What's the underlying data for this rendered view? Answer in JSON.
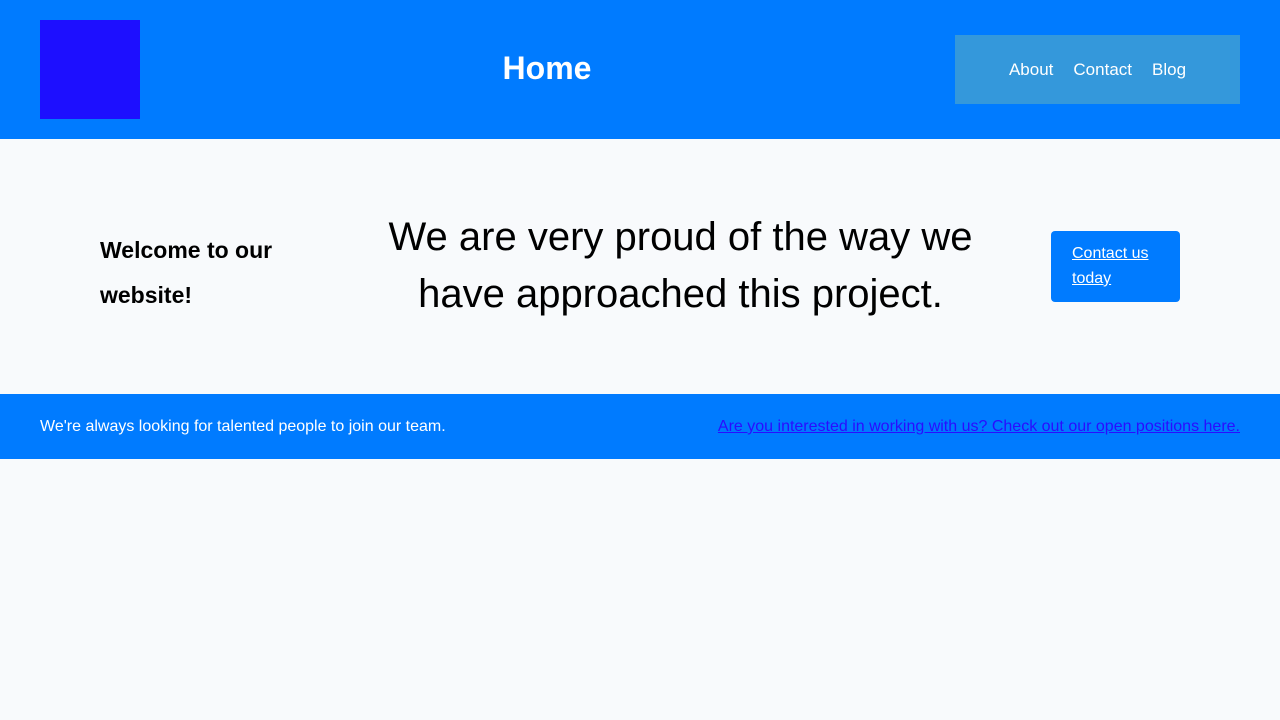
{
  "header": {
    "title": "Home",
    "nav": [
      {
        "label": "About"
      },
      {
        "label": "Contact"
      },
      {
        "label": "Blog"
      }
    ]
  },
  "hero": {
    "welcome": "Welcome to our website!",
    "statement": "We are very proud of the way we have approached this project.",
    "cta_label": "Contact us today"
  },
  "footer": {
    "text": "We're always looking for talented people to join our team.",
    "link_label": "Are you interested in working with us? Check out our open positions here."
  },
  "colors": {
    "brand_blue": "#007bff",
    "logo_blue": "#1d0fff",
    "nav_background": "#3498db",
    "page_background": "#f8fafc"
  }
}
